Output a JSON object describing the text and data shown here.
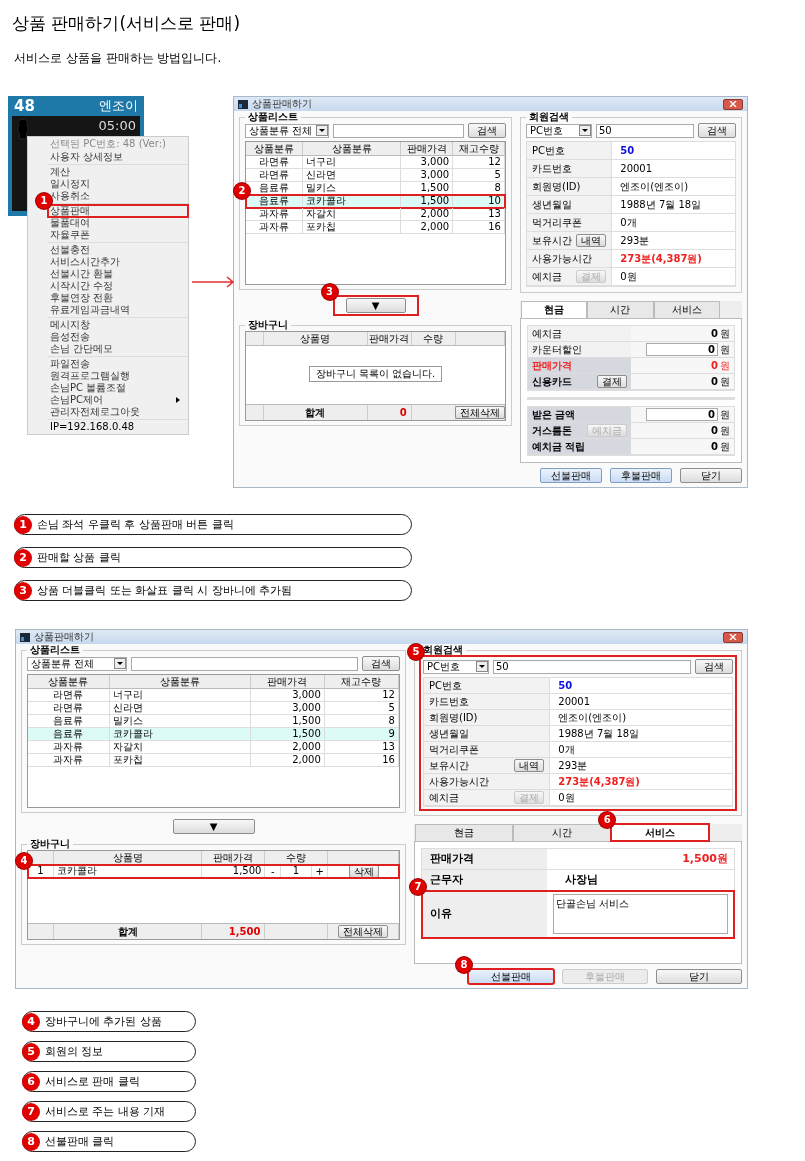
{
  "page": {
    "title": "상품 판매하기(서비스로 판매)",
    "intro": "서비스로 상품을 판매하는 방법입니다."
  },
  "pc_tile": {
    "number": "48",
    "user": "엔조이",
    "time": "05:00"
  },
  "context_menu": {
    "header": "선택된 PC번호: 48 (Ver:)",
    "groups": [
      [
        {
          "label": "사용자 상세정보",
          "submenu": false
        }
      ],
      [
        {
          "label": "계산",
          "submenu": false
        },
        {
          "label": "일시정지",
          "submenu": false
        },
        {
          "label": "사용취소",
          "submenu": false
        }
      ],
      [
        {
          "label": "상품판매",
          "submenu": false,
          "callout": "1"
        },
        {
          "label": "물품대여",
          "submenu": false
        },
        {
          "label": "자율쿠폰",
          "submenu": false
        }
      ],
      [
        {
          "label": "선불충전",
          "submenu": false
        },
        {
          "label": "서비스시간추가",
          "submenu": false
        },
        {
          "label": "선불시간 환불",
          "submenu": false
        },
        {
          "label": "시작시간 수정",
          "submenu": false
        },
        {
          "label": "후불연장 전환",
          "submenu": false
        },
        {
          "label": "유료게임과금내역",
          "submenu": false
        }
      ],
      [
        {
          "label": "메시지창",
          "submenu": false
        },
        {
          "label": "음성전송",
          "submenu": false
        },
        {
          "label": "손님 간단메모",
          "submenu": false
        }
      ],
      [
        {
          "label": "파일전송",
          "submenu": false
        },
        {
          "label": "원격프로그램실행",
          "submenu": false
        },
        {
          "label": "손님PC 볼륨조절",
          "submenu": false
        },
        {
          "label": "손님PC제어",
          "submenu": true
        },
        {
          "label": "관리자전체로그아웃",
          "submenu": false
        }
      ]
    ],
    "footer": "IP=192.168.0.48"
  },
  "steps_1": [
    {
      "number": "1",
      "text": "손님 좌석 우클릭 후 상품판매 버튼 클릭"
    },
    {
      "number": "2",
      "text": "판매할 상품 클릭"
    },
    {
      "number": "3",
      "text": "상품 더블클릭 또는 화살표 클릭 시 장바니에 추가됨"
    }
  ],
  "windows": [
    {
      "title": "상품판매하기",
      "product_list": {
        "title": "상품리스트",
        "category": "상품분류 전체",
        "search_button": "검색",
        "columns": [
          "상품분류",
          "상품분류",
          "판매가격",
          "재고수량"
        ],
        "rows": [
          {
            "cells": [
              "라면류",
              "너구리",
              "3,000",
              "12"
            ],
            "selected": false
          },
          {
            "cells": [
              "라면류",
              "신라면",
              "3,000",
              "5"
            ],
            "selected": false
          },
          {
            "cells": [
              "음료류",
              "밀키스",
              "1,500",
              "8"
            ],
            "selected": false
          },
          {
            "cells": [
              "음료류",
              "코카콜라",
              "1,500",
              "10"
            ],
            "selected": true,
            "callout": "2"
          },
          {
            "cells": [
              "과자류",
              "자갈치",
              "2,000",
              "13"
            ],
            "selected": false
          },
          {
            "cells": [
              "과자류",
              "포카칩",
              "2,000",
              "16"
            ],
            "selected": false
          }
        ]
      },
      "move_button": {
        "label": "▼",
        "callout": "3"
      },
      "cart": {
        "title": "장바구니",
        "columns": [
          "상품명",
          "판매가격",
          "수량"
        ],
        "empty_message": "장바구니 목록이 없습니다.",
        "total_label": "합계",
        "total": "0",
        "clear_button": "전체삭제"
      },
      "member": {
        "title": "회원검색",
        "field": "PC번호",
        "value": "50",
        "search_button": "검색",
        "rows": [
          {
            "label": "PC번호",
            "value": "50",
            "color": "#1010e0"
          },
          {
            "label": "카드번호",
            "value": "20001"
          },
          {
            "label": "회원명(ID)",
            "value": "엔조이(엔조이)"
          },
          {
            "label": "생년월일",
            "value": "1988년 7월 18일"
          },
          {
            "label": "먹거리쿠폰",
            "value": "0개"
          },
          {
            "label": "보유시간",
            "button": {
              "label": "내역",
              "disabled": false
            },
            "value": "293분"
          },
          {
            "label": "사용가능시간",
            "value": "273분(4,387원)",
            "color": "#f02020"
          },
          {
            "label": "예치금",
            "button": {
              "label": "결제",
              "disabled": true
            },
            "value": "0원"
          }
        ]
      },
      "payment_tabs": [
        {
          "label": "현금",
          "selected": true
        },
        {
          "label": "시간",
          "selected": false
        },
        {
          "label": "서비스",
          "selected": false
        }
      ],
      "tab_panel": {
        "kind": "cash",
        "groups": [
          [
            {
              "label": "예치금",
              "value": "0",
              "unit": "원",
              "input": false,
              "bold": false
            },
            {
              "label": "카운터할인",
              "value": "0",
              "unit": "원",
              "input": true,
              "bold": false
            },
            {
              "label": "판매가격",
              "value": "0",
              "unit": "원",
              "input": false,
              "bold": true,
              "color": "#f02020"
            },
            {
              "label": "신용카드",
              "button": {
                "label": "결제",
                "disabled": false
              },
              "value": "0",
              "unit": "원",
              "input": false,
              "bold": true
            }
          ],
          [
            {
              "label": "받은 금액",
              "value": "0",
              "unit": "원",
              "input": true,
              "bold": true
            },
            {
              "label": "거스름돈",
              "button": {
                "label": "예치금",
                "disabled": true
              },
              "value": "0",
              "unit": "원",
              "input": false,
              "bold": true
            },
            {
              "label": "예치금 적립",
              "value": "0",
              "unit": "원",
              "input": false,
              "bold": true
            }
          ]
        ]
      },
      "buttons": [
        {
          "label": "선불판매",
          "kind": "primary",
          "disabled": false
        },
        {
          "label": "후불판매",
          "kind": "primary",
          "disabled": false
        },
        {
          "label": "닫기",
          "kind": "normal",
          "disabled": false
        }
      ]
    },
    {
      "title": "상품판매하기",
      "product_list": {
        "title": "상품리스트",
        "category": "상품분류 전체",
        "search_button": "검색",
        "columns": [
          "상품분류",
          "상품분류",
          "판매가격",
          "재고수량"
        ],
        "rows": [
          {
            "cells": [
              "라면류",
              "너구리",
              "3,000",
              "12"
            ],
            "selected": false
          },
          {
            "cells": [
              "라면류",
              "신라면",
              "3,000",
              "5"
            ],
            "selected": false
          },
          {
            "cells": [
              "음료류",
              "밀키스",
              "1,500",
              "8"
            ],
            "selected": false
          },
          {
            "cells": [
              "음료류",
              "코카콜라",
              "1,500",
              "9"
            ],
            "selected": true
          },
          {
            "cells": [
              "과자류",
              "자갈치",
              "2,000",
              "13"
            ],
            "selected": false
          },
          {
            "cells": [
              "과자류",
              "포카칩",
              "2,000",
              "16"
            ],
            "selected": false
          }
        ]
      },
      "move_button": {
        "label": "▼"
      },
      "cart": {
        "title": "장바구니",
        "columns": [
          "상품명",
          "판매가격",
          "수량"
        ],
        "items": [
          {
            "no": "1",
            "name": "코카콜라",
            "price": "1,500",
            "minus": "-",
            "qty": "1",
            "plus": "+",
            "delete_button": "삭제",
            "callout": "4"
          }
        ],
        "total_label": "합계",
        "total": "1,500",
        "clear_button": "전체삭제"
      },
      "member": {
        "title": "회원검색",
        "callout": "5",
        "field": "PC번호",
        "value": "50",
        "search_button": "검색",
        "rows": [
          {
            "label": "PC번호",
            "value": "50",
            "color": "#1010e0"
          },
          {
            "label": "카드번호",
            "value": "20001"
          },
          {
            "label": "회원명(ID)",
            "value": "엔조이(엔조이)"
          },
          {
            "label": "생년월일",
            "value": "1988년 7월 18일"
          },
          {
            "label": "먹거리쿠폰",
            "value": "0개"
          },
          {
            "label": "보유시간",
            "button": {
              "label": "내역",
              "disabled": false
            },
            "value": "293분"
          },
          {
            "label": "사용가능시간",
            "value": "273분(4,387원)",
            "color": "#f02020"
          },
          {
            "label": "예치금",
            "button": {
              "label": "결제",
              "disabled": true
            },
            "value": "0원"
          }
        ]
      },
      "payment_tabs": [
        {
          "label": "현금",
          "selected": false
        },
        {
          "label": "시간",
          "selected": false
        },
        {
          "label": "서비스",
          "selected": true,
          "callout": "6"
        }
      ],
      "tab_panel": {
        "kind": "service",
        "rows": [
          {
            "label": "판매가격",
            "value": "1,500원",
            "kind": "text",
            "color": "#f02020"
          },
          {
            "label": "근무자",
            "value": "사장님",
            "kind": "text"
          },
          {
            "label": "이유",
            "value": "단골손님 서비스",
            "kind": "textarea",
            "callout": "7"
          }
        ]
      },
      "buttons": [
        {
          "label": "선불판매",
          "kind": "primary",
          "disabled": false,
          "callout": "8"
        },
        {
          "label": "후불판매",
          "kind": "primary",
          "disabled": true
        },
        {
          "label": "닫기",
          "kind": "normal",
          "disabled": false
        }
      ]
    }
  ],
  "steps_2": [
    {
      "number": "4",
      "text": "장바구니에 추가된 상품"
    },
    {
      "number": "5",
      "text": "회원의 정보"
    },
    {
      "number": "6",
      "text": "서비스로 판매 클릭"
    },
    {
      "number": "7",
      "text": "서비스로 주는 내용 기재"
    },
    {
      "number": "8",
      "text": "선불판매 클릭"
    }
  ]
}
